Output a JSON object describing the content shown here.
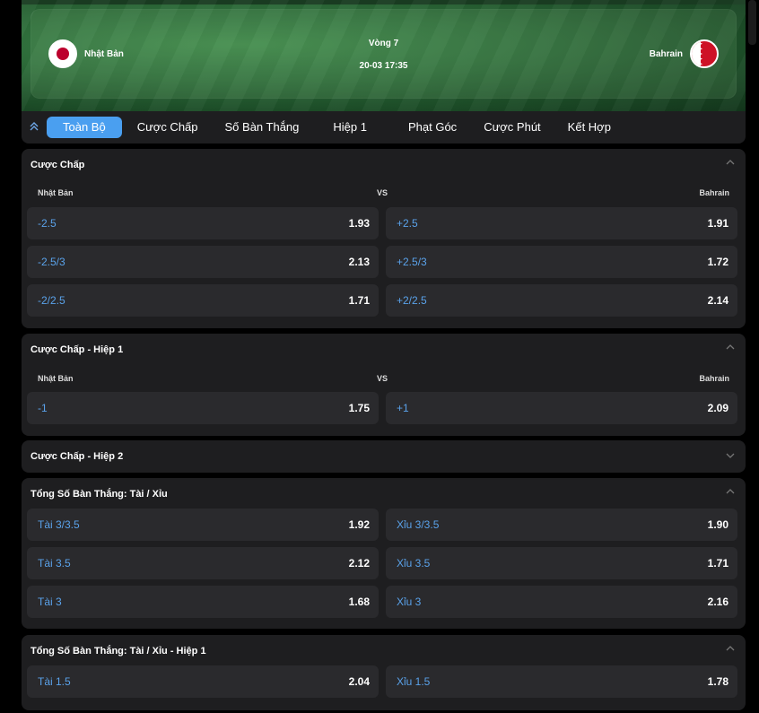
{
  "match": {
    "home": "Nhật Bản",
    "away": "Bahrain",
    "round": "Vòng 7",
    "time": "20-03 17:35"
  },
  "tabs": [
    "Toàn Bộ",
    "Cược Chấp",
    "Số Bàn Thắng",
    "Hiệp 1",
    "Phạt Góc",
    "Cược Phút",
    "Kết Hợp"
  ],
  "vs_label": "VS",
  "sections": {
    "handicap": {
      "title": "Cược Chấp",
      "home": "Nhật Bản",
      "away": "Bahrain",
      "rows": [
        {
          "l_lbl": "-2.5",
          "l_odd": "1.93",
          "r_lbl": "+2.5",
          "r_odd": "1.91"
        },
        {
          "l_lbl": "-2.5/3",
          "l_odd": "2.13",
          "r_lbl": "+2.5/3",
          "r_odd": "1.72"
        },
        {
          "l_lbl": "-2/2.5",
          "l_odd": "1.71",
          "r_lbl": "+2/2.5",
          "r_odd": "2.14"
        }
      ]
    },
    "handicap_h1": {
      "title": "Cược Chấp - Hiệp 1",
      "home": "Nhật Bản",
      "away": "Bahrain",
      "rows": [
        {
          "l_lbl": "-1",
          "l_odd": "1.75",
          "r_lbl": "+1",
          "r_odd": "2.09"
        }
      ]
    },
    "handicap_h2": {
      "title": "Cược Chấp - Hiệp 2"
    },
    "totals": {
      "title": "Tổng Số Bàn Thắng: Tài / Xỉu",
      "rows": [
        {
          "l_lbl": "Tài 3/3.5",
          "l_odd": "1.92",
          "r_lbl": "Xỉu 3/3.5",
          "r_odd": "1.90"
        },
        {
          "l_lbl": "Tài 3.5",
          "l_odd": "2.12",
          "r_lbl": "Xỉu 3.5",
          "r_odd": "1.71"
        },
        {
          "l_lbl": "Tài 3",
          "l_odd": "1.68",
          "r_lbl": "Xỉu 3",
          "r_odd": "2.16"
        }
      ]
    },
    "totals_h1": {
      "title": "Tổng Số Bàn Thắng: Tài / Xỉu - Hiệp 1",
      "rows": [
        {
          "l_lbl": "Tài 1.5",
          "l_odd": "2.04",
          "r_lbl": "Xỉu 1.5",
          "r_odd": "1.78"
        }
      ]
    }
  },
  "icons": {
    "collapse_all": "double-chevron-up-icon",
    "expand": "chevron-up-icon",
    "collapsed": "chevron-down-icon"
  },
  "colors": {
    "accent": "#4a9ff0",
    "odds_label": "#5aa2ea",
    "panel": "#1e1e20",
    "cell": "#2a2a2d"
  }
}
